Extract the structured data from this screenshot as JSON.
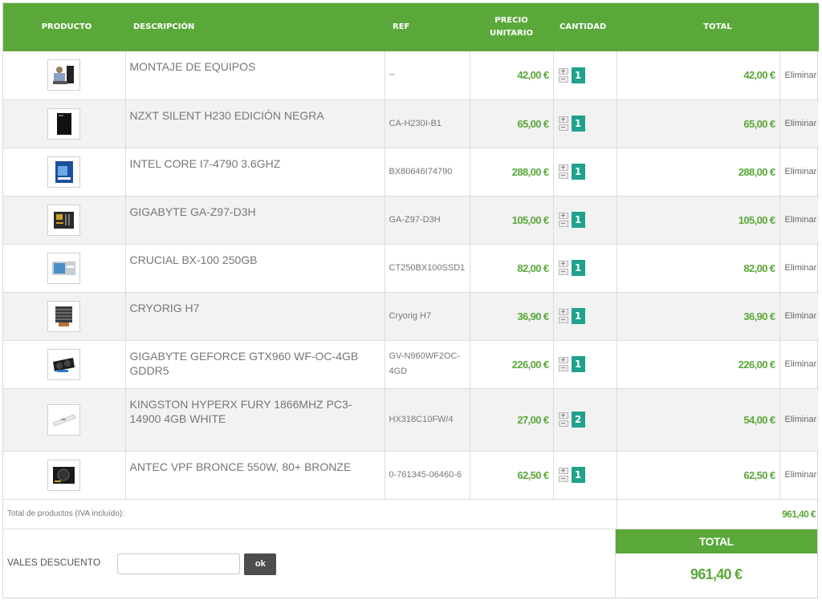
{
  "headers": {
    "producto": "PRODUCTO",
    "descripcion": "DESCRIPCIÓN",
    "ref": "REF",
    "precio_1": "PRECIO",
    "precio_2": "UNITARIO",
    "cantidad": "CANTIDAD",
    "total": "TOTAL"
  },
  "items": [
    {
      "name": "MONTAJE DE EQUIPOS",
      "ref": "--",
      "unit_price": "42,00 €",
      "quantity": "1",
      "total": "42,00 €",
      "delete": "Eliminar",
      "thumb": "pc-assembly-image"
    },
    {
      "name": "NZXT SILENT H230 EDICIÓN NEGRA",
      "ref": "CA-H230I-B1",
      "unit_price": "65,00 €",
      "quantity": "1",
      "total": "65,00 €",
      "delete": "Eliminar",
      "thumb": "pc-case-image"
    },
    {
      "name": "INTEL CORE I7-4790 3.6GHZ",
      "ref": "BX80646I74790",
      "unit_price": "288,00 €",
      "quantity": "1",
      "total": "288,00 €",
      "delete": "Eliminar",
      "thumb": "cpu-box-image"
    },
    {
      "name": "GIGABYTE GA-Z97-D3H",
      "ref": "GA-Z97-D3H",
      "unit_price": "105,00 €",
      "quantity": "1",
      "total": "105,00 €",
      "delete": "Eliminar",
      "thumb": "motherboard-image"
    },
    {
      "name": "CRUCIAL BX-100 250GB",
      "ref": "CT250BX100SSD1",
      "unit_price": "82,00 €",
      "quantity": "1",
      "total": "82,00 €",
      "delete": "Eliminar",
      "thumb": "ssd-image"
    },
    {
      "name": "CRYORIG H7",
      "ref": "Cryorig H7",
      "unit_price": "36,90 €",
      "quantity": "1",
      "total": "36,90 €",
      "delete": "Eliminar",
      "thumb": "cpu-cooler-image"
    },
    {
      "name": "GIGABYTE GEFORCE GTX960 WF-OC-4GB GDDR5",
      "ref": "GV-N960WF2OC-4GD",
      "unit_price": "226,00 €",
      "quantity": "1",
      "total": "226,00 €",
      "delete": "Eliminar",
      "thumb": "graphics-card-image"
    },
    {
      "name": "KINGSTON HYPERX FURY 1866MHZ PC3-14900 4GB WHITE",
      "ref": "HX318C10FW/4",
      "unit_price": "27,00 €",
      "quantity": "2",
      "total": "54,00 €",
      "delete": "Eliminar",
      "thumb": "ram-module-image"
    },
    {
      "name": "ANTEC VPF BRONCE 550W, 80+ BRONZE",
      "ref": "0-761345-06460-6",
      "unit_price": "62,50 €",
      "quantity": "1",
      "total": "62,50 €",
      "delete": "Eliminar",
      "thumb": "power-supply-image"
    }
  ],
  "qty_controls": {
    "plus": "+",
    "minus": "−"
  },
  "subtotal": {
    "label": "Total de productos (IVA incluído):",
    "value": "961,40 €"
  },
  "voucher": {
    "label": "VALES DESCUENTO",
    "input_value": "",
    "button": "ok"
  },
  "grand_total": {
    "label": "TOTAL",
    "value": "961,40 €"
  },
  "colors": {
    "accent": "#5aa83a",
    "qty_badge": "#1fa28a",
    "button_dark": "#4d4d4d"
  }
}
